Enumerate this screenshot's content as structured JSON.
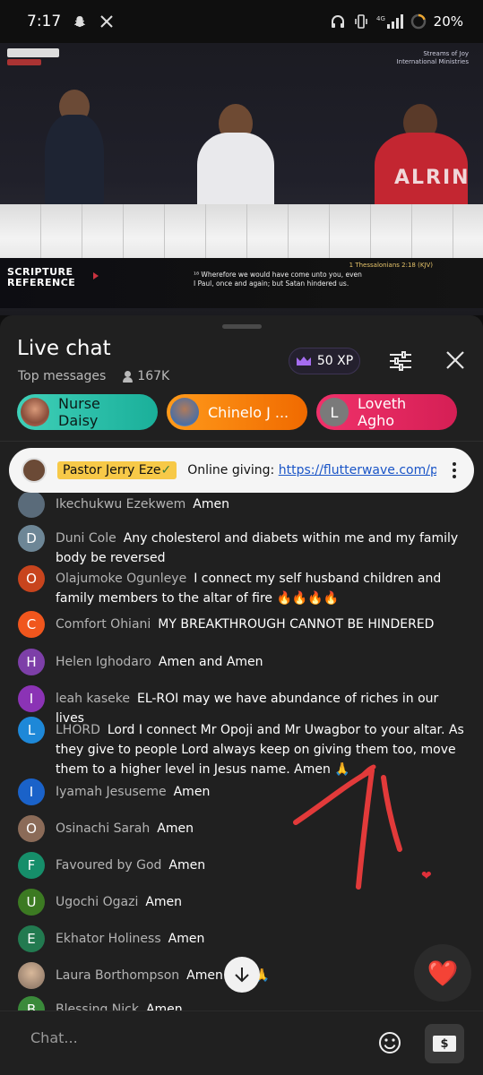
{
  "status_bar": {
    "time": "7:17",
    "left_icons": [
      "snapchat-icon",
      "x-icon"
    ],
    "right_icons": [
      "headphones-icon",
      "vibrate-icon",
      "signal-icon",
      "battery-icon"
    ],
    "network": "4G",
    "battery": "20%"
  },
  "video": {
    "overlay_title_line1": "SCRIPTURE",
    "overlay_title_line2": "REFERENCE",
    "scripture_ref": "1 Thessalonians 2:18 (KJV)",
    "scripture_line1": "¹⁸ Wherefore we would have come unto you, even",
    "scripture_line2": "I Paul, once and again; but Satan hindered us.",
    "brand_line1": "Streams of Joy",
    "brand_line2": "International Ministries",
    "shirt_text": "ALRIN"
  },
  "chat": {
    "title": "Live chat",
    "mode": "Top messages",
    "viewer_count": "167K",
    "xp_label": "50 XP",
    "chips": [
      {
        "name": "Nurse Daisy"
      },
      {
        "name": "Chinelo J ..."
      },
      {
        "name": "Loveth Agho",
        "initial": "L"
      }
    ],
    "pinned": {
      "author": "Pastor Jerry Eze",
      "verified": "✓",
      "text": "Online giving: ",
      "link": "https://flutterwave.com/pa..."
    },
    "messages": [
      {
        "initial": "",
        "color": "#5a6b7a",
        "name": "Ikechukwu Ezekwem",
        "text": "Amen"
      },
      {
        "initial": "D",
        "color": "#6d8696",
        "name": "Duni Cole",
        "text": "Any cholesterol and diabets within me and my family body be reversed"
      },
      {
        "initial": "O",
        "color": "#c8441d",
        "name": "Olajumoke Ogunleye",
        "text": "I connect my self husband children and family members to the altar of fire 🔥🔥🔥🔥"
      },
      {
        "initial": "C",
        "color": "#f0561d",
        "name": "Comfort Ohiani",
        "text": "MY BREAKTHROUGH CANNOT BE HINDERED"
      },
      {
        "initial": "H",
        "color": "#7d3fa8",
        "name": "Helen Ighodaro",
        "text": "Amen and Amen"
      },
      {
        "initial": "I",
        "color": "#8b33b5",
        "name": "leah kaseke",
        "text": "EL-ROI may we have abundance of riches in our lives"
      },
      {
        "initial": "L",
        "color": "#1e88d8",
        "name": "LHORD",
        "text": "Lord I connect Mr Opoji and Mr Uwagbor to your altar.  As they give to people Lord always keep on giving them too,  move them to a higher level in Jesus name.  Amen 🙏"
      },
      {
        "initial": "I",
        "color": "#1a62c9",
        "name": "Iyamah Jesuseme",
        "text": "Amen"
      },
      {
        "initial": "O",
        "color": "#8b6b58",
        "name": "Osinachi Sarah",
        "text": "Amen"
      },
      {
        "initial": "F",
        "color": "#168e6a",
        "name": "Favoured by God",
        "text": "Amen"
      },
      {
        "initial": "U",
        "color": "#3c7a22",
        "name": "Ugochi Ogazi",
        "text": "Amen"
      },
      {
        "initial": "E",
        "color": "#227a50",
        "name": "Ekhator Holiness",
        "text": "Amen"
      },
      {
        "initial": "",
        "color": "#9b8370",
        "name": "Laura Borthompson",
        "text": "Amen🙏🙏🙏"
      },
      {
        "initial": "B",
        "color": "#3a8a3a",
        "name": "Blessing Nick",
        "text": "Amen"
      }
    ],
    "input_placeholder": "Chat...",
    "heart_emoji": "❤️",
    "float_heart": "❤"
  },
  "colors": {
    "panel_bg": "#202020",
    "pinned_author_bg": "#f7c948",
    "link": "#1a55c7",
    "annotation_red": "#e23a3a"
  }
}
